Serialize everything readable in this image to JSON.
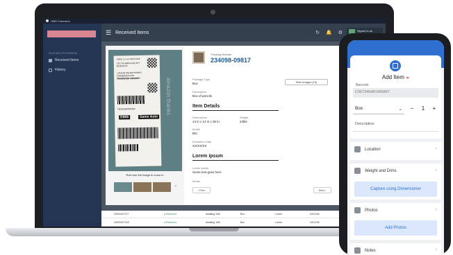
{
  "laptop": {
    "topbar_title": "HMD Extension",
    "sidebar": {
      "section": "RUN MID EXTENSION",
      "items": [
        {
          "label": "Received Items"
        },
        {
          "label": "History"
        }
      ]
    },
    "header": {
      "menu_glyph": "☰",
      "title": "Received Items",
      "refresh_glyph": "↻",
      "notify_glyph": "🔔",
      "settings_glyph": "⚙",
      "signed_in": "Signed in as"
    },
    "modal": {
      "photo": {
        "zoom_hint": "Roll over the image to zoom in",
        "label_lines": [
          "CN5E 1.1 Lbs 09/12 06/6",
          "135 CALABRIA AVE APT MORAN NY",
          "LITHIUM ION BATTERIES -",
          "FORBIDDEN FOR TRANSPORT ABOARD",
          "PASSENGER AIRCRAFT",
          "TBA563680485002"
        ],
        "label_codes": [
          "DMI6",
          "Same Auto"
        ],
        "overlay_text": "amazon thanks",
        "next_glyph": "›"
      },
      "tracking_label": "Tracking Number",
      "tracking_number": "234098-09817",
      "close_glyph": "×",
      "package_type_label": "Package Type",
      "package_type": "Box",
      "description_label": "Description",
      "description": "Box of pencils",
      "hide_images": "Hide Images (10)",
      "item_details_title": "Item Details",
      "dimensions_label": "Dimensions",
      "dimensions": "14 in x 13 in x 36 in",
      "weight_label": "Weight",
      "weight": "24lbs",
      "model_label": "Model",
      "model": "BIC",
      "expiration_label": "Expiration Date",
      "expiration": "XX/XX/XX",
      "lorem_title": "Lorem ipsum",
      "lorem_label": "Lorem ipsum",
      "lorem_value": "Some text goes here",
      "model2_label": "Model",
      "prev": "‹ Prev",
      "next": "Next ›"
    },
    "table_rows": [
      {
        "id": "2300341T217",
        "status": "● Received",
        "tracking": "Awaiting 10th",
        "type": "Box",
        "name": "Lorem",
        "date": "04/14/26"
      },
      {
        "id": "2300341T218",
        "status": "● Received",
        "tracking": "Awaiting 10th",
        "type": "Box",
        "name": "Lorem",
        "date": "04/14/26"
      }
    ]
  },
  "phone": {
    "title": "Add Item",
    "title_mark": "⇹",
    "barcode_label": "Barcode",
    "barcode_value": "C967346481495867",
    "package_select": "Box",
    "select_chevron": "⌄",
    "minus": "−",
    "quantity": "1",
    "plus": "+",
    "description_placeholder": "Description",
    "rows": [
      {
        "label": "Location"
      },
      {
        "label": "Weight and Dims"
      },
      {
        "label": "Photos"
      },
      {
        "label": "Notes"
      }
    ],
    "capture_button": "Capture using Dimensioner",
    "add_photos_button": "Add Photos",
    "chevron": "›"
  },
  "colors": {
    "brand_blue": "#2f6fcf",
    "tracking_blue": "#1f5c94",
    "sidebar": "#233552",
    "brand_pink": "#d88692"
  }
}
